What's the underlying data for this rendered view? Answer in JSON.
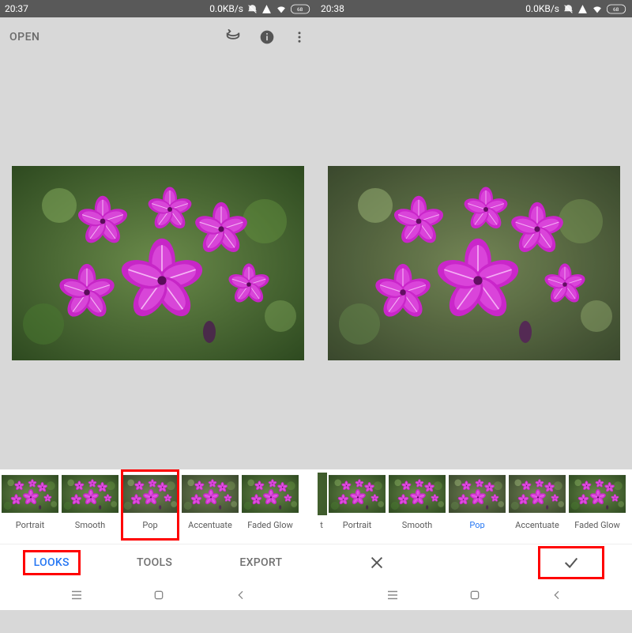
{
  "left": {
    "statusbar": {
      "time": "20:37",
      "data": "0.0KB/s",
      "battery": "68"
    },
    "toolbar": {
      "open_label": "OPEN"
    },
    "filters": [
      {
        "label": "Portrait"
      },
      {
        "label": "Smooth"
      },
      {
        "label": "Pop",
        "redbox": true
      },
      {
        "label": "Accentuate"
      },
      {
        "label": "Faded Glow"
      }
    ],
    "tabs": {
      "looks": "LOOKS",
      "tools": "TOOLS",
      "export": "EXPORT",
      "active": "looks"
    }
  },
  "right": {
    "statusbar": {
      "time": "20:38",
      "data": "0.0KB/s",
      "battery": "68"
    },
    "filters": [
      {
        "label": "t",
        "partial_left": true
      },
      {
        "label": "Portrait"
      },
      {
        "label": "Smooth"
      },
      {
        "label": "Pop",
        "selected": true
      },
      {
        "label": "Accentuate"
      },
      {
        "label": "Faded Glow"
      }
    ],
    "actions": {
      "cancel": "close-icon",
      "confirm": "check-icon"
    }
  },
  "icons": {
    "layers": "layers-icon",
    "info": "info-icon",
    "overflow": "more-vert-icon"
  }
}
